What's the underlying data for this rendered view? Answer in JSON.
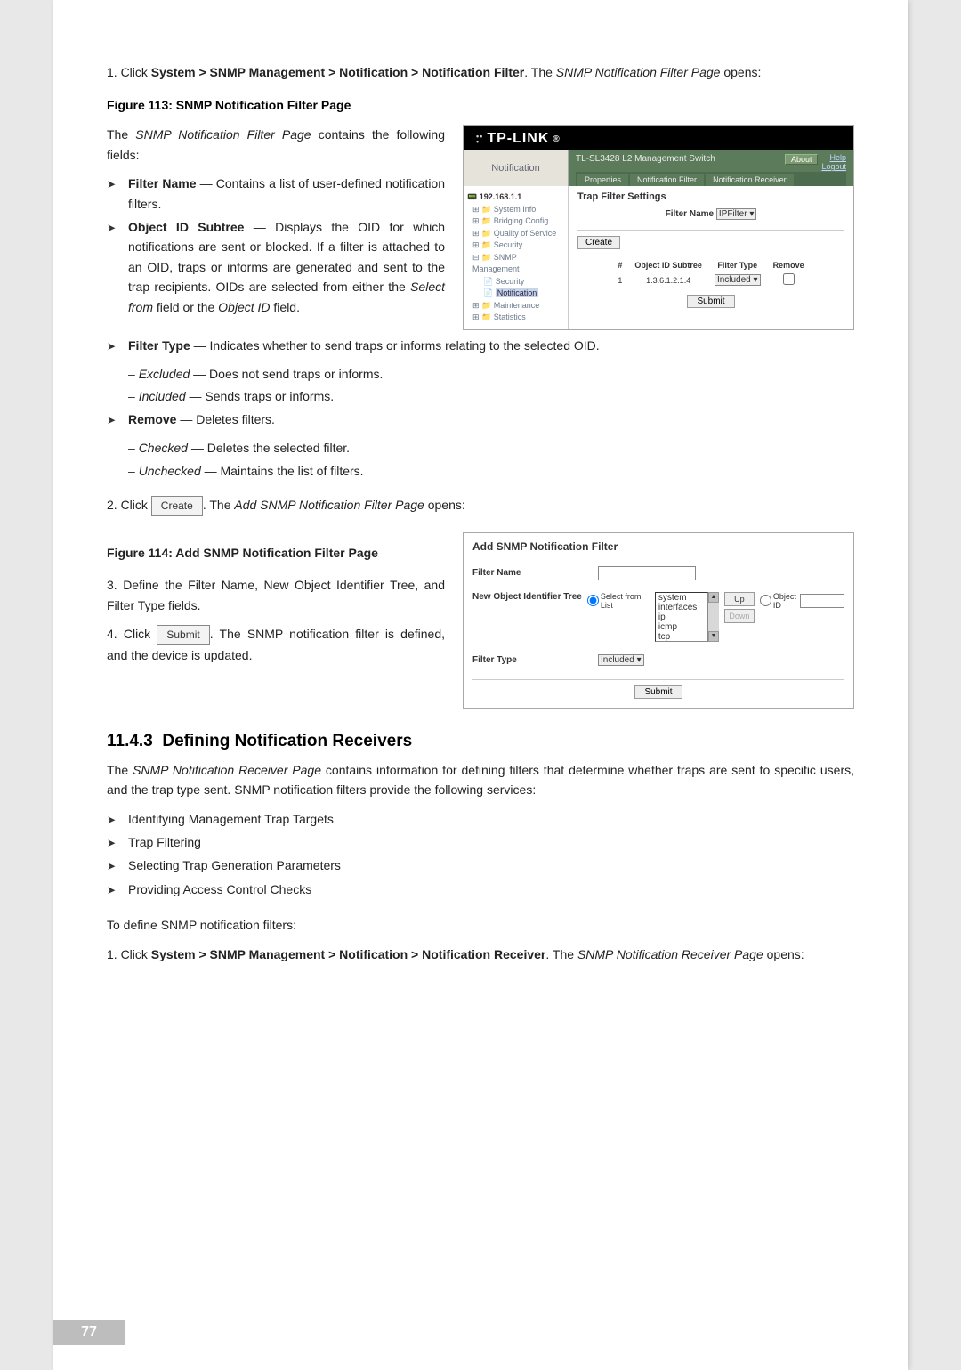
{
  "step1": {
    "prefix": "1.  Click ",
    "path": "System > SNMP Management > Notification > Notification Filter",
    "mid": ". The ",
    "pageName": "SNMP Notification Filter Page",
    "suffix": " opens:"
  },
  "fig113": {
    "caption": "Figure 113: SNMP Notification Filter Page"
  },
  "intro113": {
    "pre": "The ",
    "pageName": "SNMP Notification Filter Page",
    "post": " contains the following fields:"
  },
  "bullet113a": {
    "title": "Filter Name",
    "sep": " — ",
    "desc": "Contains a list of user-defined notification filters."
  },
  "bullet113b": {
    "title": "Object ID Subtree",
    "sep": " — ",
    "desc": "Displays the OID for which notifications are sent or blocked. If a filter is attached to an OID, traps or informs are generated and sent to the trap recipients. OIDs are selected from either the ",
    "sel": "Select from",
    "mid": " field or the ",
    "obj": "Object ID",
    "end": " field."
  },
  "bullet113c": {
    "title": "Filter Type",
    "sep": " — ",
    "desc": "Indicates whether to send traps or informs relating to the selected OID.",
    "sub1name": "Excluded",
    "sub1desc": " — Does not send traps or informs.",
    "sub2name": "Included",
    "sub2desc": " — Sends traps or informs."
  },
  "bullet113d": {
    "title": "Remove",
    "sep": " — ",
    "desc": "Deletes filters.",
    "sub1name": "Checked",
    "sub1desc": " — Deletes the selected filter.",
    "sub2name": "Unchecked",
    "sub2desc": " — Maintains the list of filters."
  },
  "step2": {
    "prefix": "2.  Click ",
    "btn": "Create",
    "mid": ". The ",
    "pageName": "Add SNMP Notification Filter Page",
    "suffix": " opens:"
  },
  "fig114": {
    "caption": "Figure 114: Add SNMP Notification Filter Page"
  },
  "step3": "3.  Define the Filter Name, New Object Identifier Tree, and Filter Type fields.",
  "step4": {
    "prefix": "4.  Click ",
    "btn": "Submit",
    "suffix": ". The SNMP notification filter is defined, and the device is updated."
  },
  "h3_num": "11.4.3",
  "h3_title": "Defining Notification Receivers",
  "recvIntro": {
    "pre": "The ",
    "pageName": "SNMP Notification Receiver Page",
    "post": " contains information for defining filters that determine whether traps are sent to specific users, and the trap type sent. SNMP notification filters provide the following services:"
  },
  "recvBullets": {
    "b1": "Identifying Management Trap Targets",
    "b2": "Trap Filtering",
    "b3": "Selecting Trap Generation Parameters",
    "b4": "Providing Access Control Checks"
  },
  "defineLine": "To define SNMP notification filters:",
  "recvStep1": {
    "prefix": "1.   Click ",
    "path": "System > SNMP Management > Notification > Notification Receiver",
    "mid": ". The ",
    "pageName": "SNMP Notification Receiver Page",
    "suffix": " opens:"
  },
  "pageNum": "77",
  "shot113": {
    "brand": "TP-LINK",
    "switchName": "TL-SL3428 L2 Management Switch",
    "navLabel": "Notification",
    "about": "About",
    "help": "Help",
    "logout": "Logout",
    "tabs": {
      "t1": "Properties",
      "t2": "Notification Filter",
      "t3": "Notification Receiver"
    },
    "tree": {
      "root": "192.168.1.1",
      "n1": "System Info",
      "n2": "Bridging Config",
      "n3": "Quality of Service",
      "n4": "Security",
      "n5": "SNMP Management",
      "n5a": "Security",
      "n5b": "Notification",
      "n6": "Maintenance",
      "n7": "Statistics"
    },
    "sectionTitle": "Trap Filter Settings",
    "filterNameLbl": "Filter Name",
    "filterNameVal": "IPFilter",
    "createBtn": "Create",
    "th1": "#",
    "th2": "Object ID Subtree",
    "th3": "Filter Type",
    "th4": "Remove",
    "rowIdx": "1",
    "rowOid": "1.3.6.1.2.1.4",
    "rowType": "Included",
    "submit": "Submit"
  },
  "shot114": {
    "title": "Add SNMP Notification Filter",
    "filterNameLbl": "Filter Name",
    "newObjLbl": "New Object Identifier Tree",
    "selectFromList": "Select from List",
    "listItems": {
      "i1": "system",
      "i2": "interfaces",
      "i3": "ip",
      "i4": "icmp",
      "i5": "tcp"
    },
    "upBtn": "Up",
    "downBtn": "Down",
    "objectIdLbl": "Object ID",
    "filterTypeLbl": "Filter Type",
    "filterTypeVal": "Included",
    "submit": "Submit"
  }
}
